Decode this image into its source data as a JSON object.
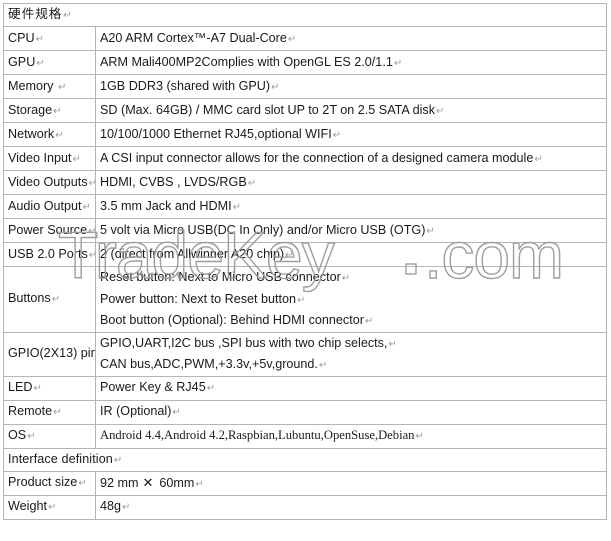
{
  "document": {
    "title": "硬件规格",
    "paragraph_mark": "↵"
  },
  "banners": {
    "hardware": "硬件规格",
    "interface": "Interface definition"
  },
  "table": {
    "rows": [
      {
        "label": "CPU",
        "value": "A20 ARM Cortex™-A7 Dual-Core"
      },
      {
        "label": "GPU",
        "value": "ARM Mali400MP2Complies with OpenGL ES 2.0/1.1"
      },
      {
        "label": "Memory ",
        "value": "1GB DDR3 (shared with GPU)"
      },
      {
        "label": "Storage",
        "value": "SD (Max. 64GB) / MMC card slot UP to 2T on 2.5 SATA disk"
      },
      {
        "label": "Network",
        "value": "10/100/1000 Ethernet RJ45,optional WIFI"
      },
      {
        "label": "Video Input",
        "value": "A CSI input connector allows for the connection of a designed camera module"
      },
      {
        "label": "Video Outputs",
        "value": "HDMI, CVBS , LVDS/RGB"
      },
      {
        "label": "Audio Output",
        "value": "3.5 mm Jack and HDMI"
      },
      {
        "label": "Power Source",
        "value": "5 volt via Micro USB(DC In Only) and/or Micro USB (OTG)"
      },
      {
        "label": "USB 2.0 Ports",
        "value": "2 (direct from Allwinner A20 chip)"
      }
    ],
    "buttons_row": {
      "label": "Buttons",
      "lines": [
        "Reset button: Next to Micro USB connector",
        "Power button: Next to Reset button",
        "Boot button (Optional): Behind HDMI connector"
      ]
    },
    "gpio_row": {
      "label": "GPIO(2X13) pin",
      "lines": [
        "GPIO,UART,I2C bus ,SPI bus with two chip selects,",
        "CAN bus,ADC,PWM,+3.3v,+5v,ground."
      ]
    },
    "tail_rows": [
      {
        "label": "LED",
        "value": "Power Key & RJ45"
      },
      {
        "label": "Remote",
        "value": "IR (Optional)"
      }
    ],
    "os_row": {
      "label": "OS",
      "value": "Android 4.4,Android 4.2,Raspbian,Lubuntu,OpenSuse,Debian"
    },
    "interface_rows": [
      {
        "label": "Product size",
        "value_a": "92 mm",
        "symbol": "✕",
        "value_b": "60mm"
      },
      {
        "label": "Weight",
        "value": "48g"
      }
    ]
  },
  "watermark": {
    "text": "TradeKey",
    "suffix": ".com"
  },
  "colors": {
    "banner_blue": "#9ac7f2",
    "border_gray": "#b5b5b5",
    "text": "#1a1a1a",
    "paragraph_mark": "#9a9a9a",
    "watermark_stroke": "#9e9e9e",
    "page_background": "#ffffff"
  }
}
